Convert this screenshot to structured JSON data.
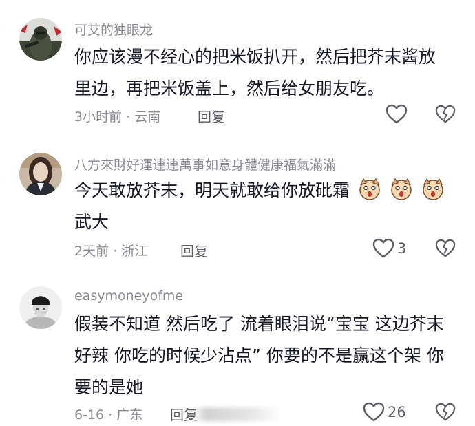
{
  "comments": [
    {
      "username": "可艾的独眼龙",
      "text_lines": [
        "你应该漫不经心的把米饭扒开，然后把芥末酱放",
        "里边，再把米饭盖上，然后给女朋友吃。"
      ],
      "meta": "3小时前 · 云南",
      "reply_label": "回复",
      "like_count": "",
      "avatar_icon": "soldier-avatar-icon"
    },
    {
      "username": "八方來財好運連連萬事如意身體健康福氣滿滿",
      "text_lines": [
        "今天敢放芥末，明天就敢给你放砒霜",
        "武大"
      ],
      "emoji_icon": "shocked-dog-emoji-icon",
      "emoji_count": 3,
      "meta": "2天前 · 浙江",
      "reply_label": "回复",
      "like_count": "3",
      "avatar_icon": "long-hair-person-avatar-icon"
    },
    {
      "username": "easymoneyofme",
      "text_lines": [
        "假装不知道 然后吃了 流着眼泪说“宝宝 这边芥末",
        "好辣 你吃的时候少沾点” 你要的不是赢这个架 你",
        "要的是她"
      ],
      "meta": "6-16 · 广东",
      "reply_label": "回复",
      "like_count": "26",
      "avatar_icon": "beanie-person-avatar-icon"
    }
  ],
  "colors": {
    "text": "#161823",
    "secondary": "#8a8b91",
    "icon": "#5c5d63"
  },
  "icons": {
    "like": "heart-outline-icon",
    "dislike": "broken-heart-icon"
  }
}
